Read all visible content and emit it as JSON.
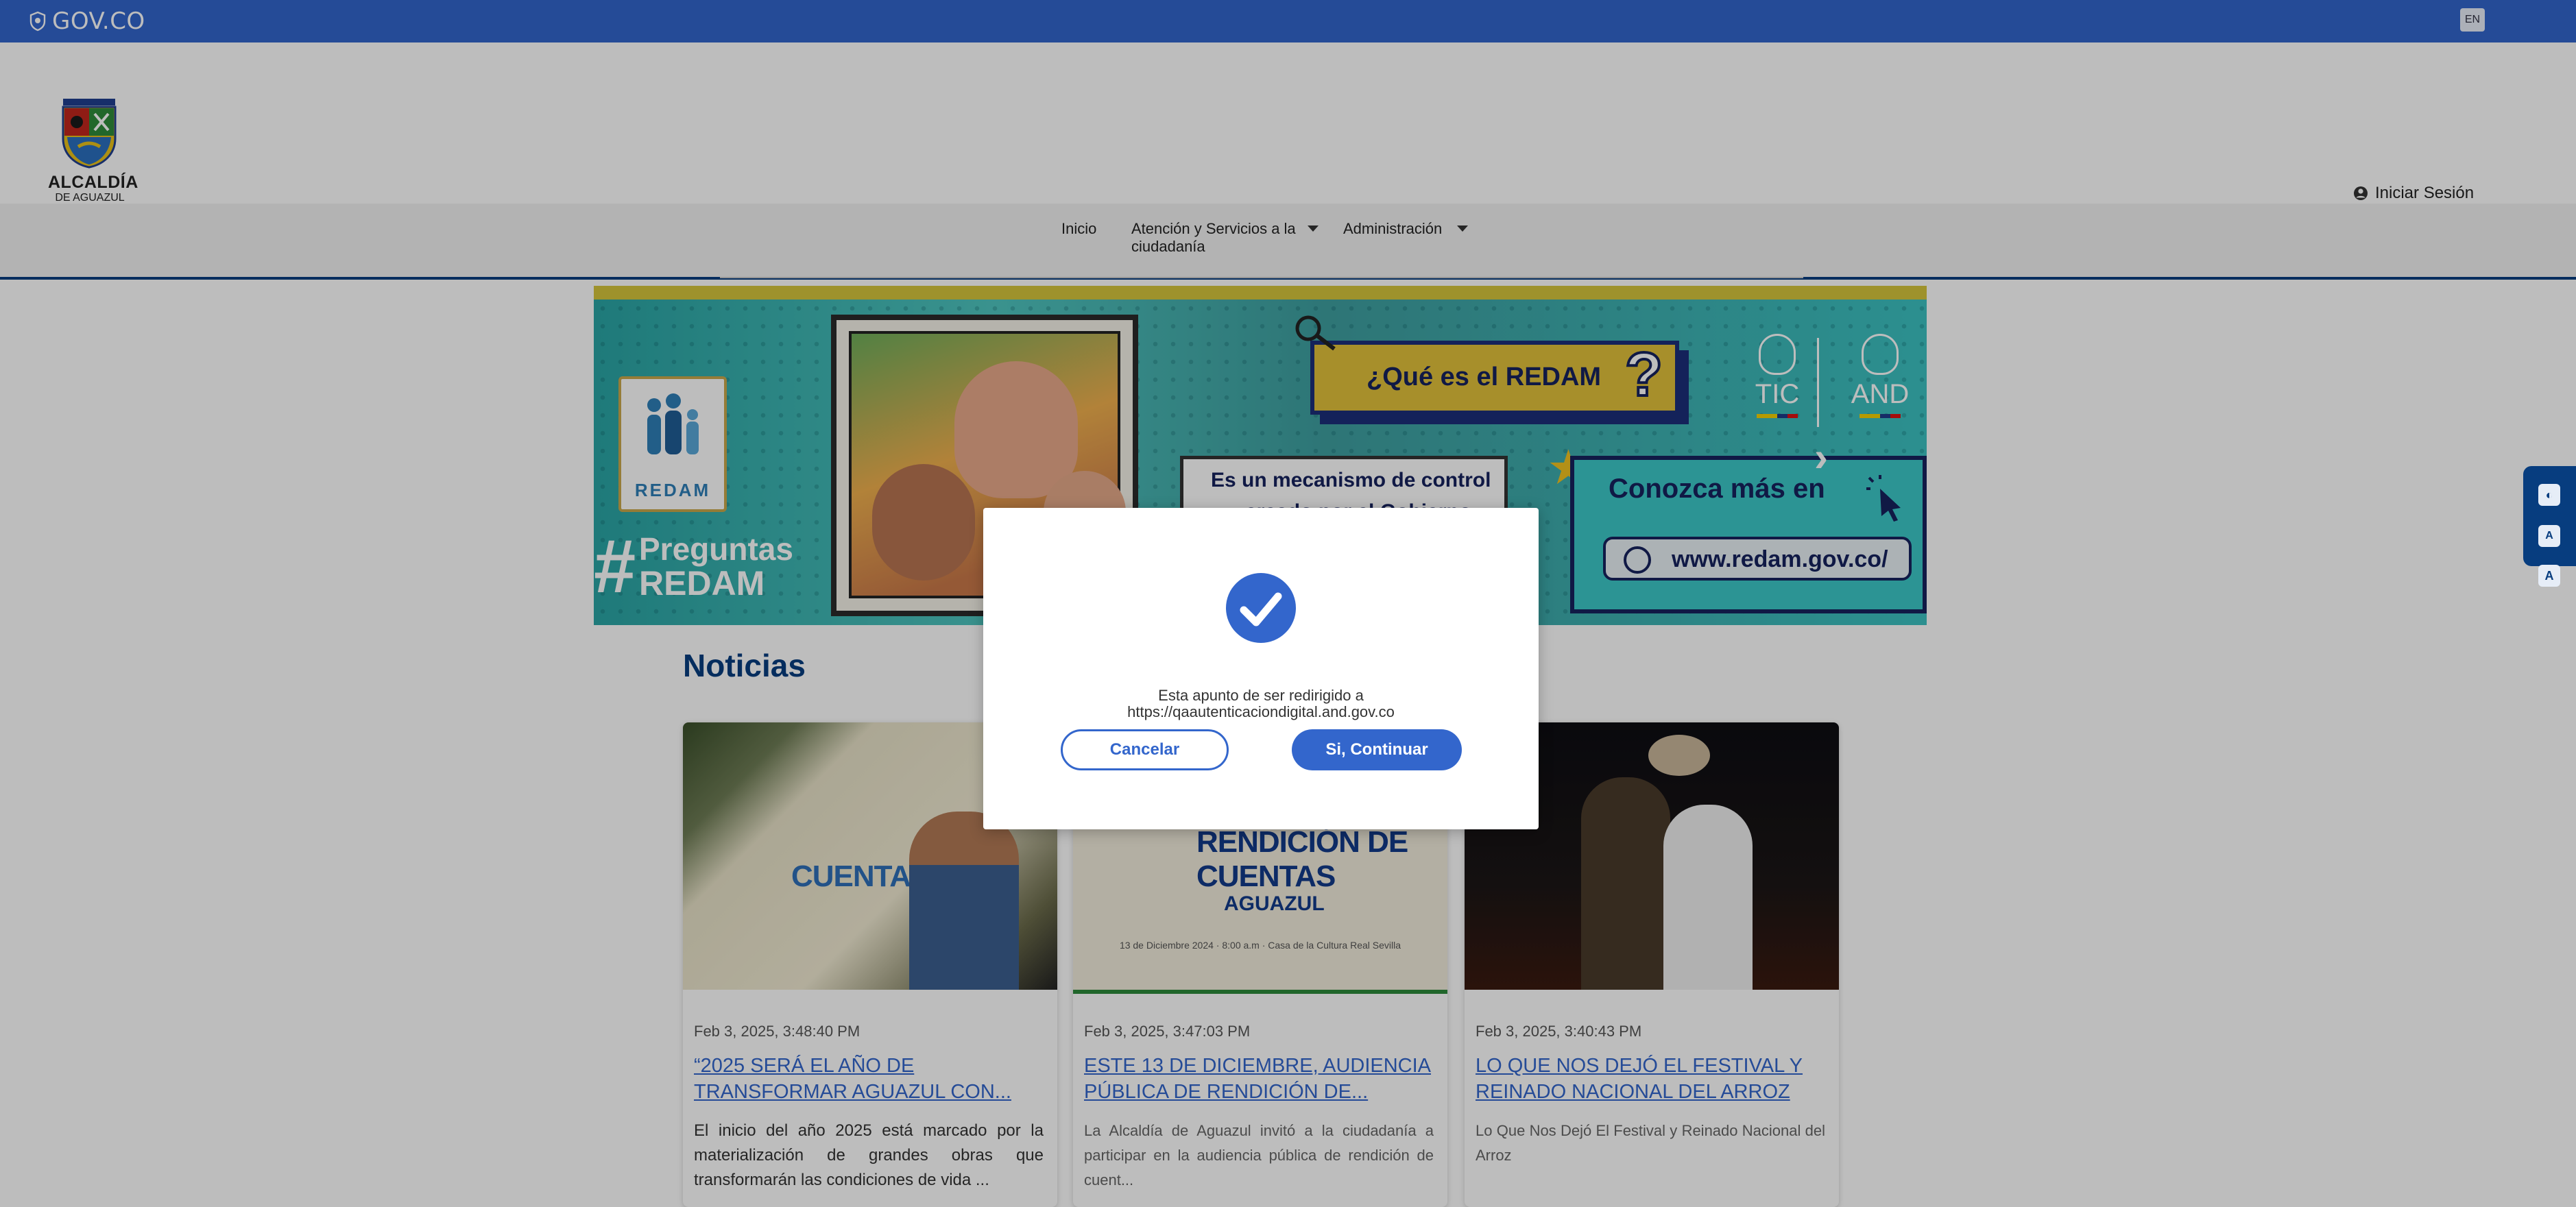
{
  "topbar": {
    "brand": "GOV.CO",
    "lang": "EN"
  },
  "header": {
    "logo_name": "ALCALDÍA",
    "logo_sub": "DE AGUAZUL",
    "login": "Iniciar Sesión"
  },
  "nav": {
    "items": [
      {
        "label": "Inicio"
      },
      {
        "label": "Atención y Servicios a la ciudadanía"
      },
      {
        "label": "Administración"
      }
    ]
  },
  "banner": {
    "logo_text": "REDAM",
    "hashtag": "#",
    "preguntas_l1": "Preguntas",
    "preguntas_l2": "REDAM",
    "question": "¿Qué es el REDAM",
    "question_mark": "?",
    "mecanismo_l1": "Es un mecanismo de control",
    "mecanismo_l2": "creado por el Gobierno",
    "tic": "TIC",
    "and": "AND",
    "conozca": "Conozca más en",
    "url": "www.redam.gov.co/"
  },
  "news": {
    "heading": "Noticias",
    "cards": [
      {
        "image_text": "CUENTAS",
        "date": "Feb 3, 2025, 3:48:40 PM",
        "title": "“2025 SERÁ EL AÑO DE TRANSFORMAR AGUAZUL CON...",
        "desc": "El inicio del año 2025 está marcado por la materialización de grandes obras que transformarán las condiciones de vida ..."
      },
      {
        "image_text": "RENDICIÓN DE CUENTAS",
        "image_sub": "AGUAZUL",
        "image_detail": "13 de Diciembre 2024 · 8:00 a.m · Casa de la Cultura Real Sevilla",
        "date": "Feb 3, 2025, 3:47:03 PM",
        "title": "ESTE 13 DE DICIEMBRE, AUDIENCIA PÚBLICA DE RENDICIÓN DE...",
        "desc": "La Alcaldía de Aguazul invitó a la ciudadanía a participar en la audiencia pública de rendición de cuent..."
      },
      {
        "date": "Feb 3, 2025, 3:40:43 PM",
        "title": "LO QUE NOS DEJÓ EL FESTIVAL Y REINADO NACIONAL DEL ARROZ",
        "desc": "Lo Que Nos Dejó El Festival y Reinado Nacional del Arroz"
      }
    ]
  },
  "modal": {
    "message_l1": "Esta apunto de ser redirigido a",
    "message_l2": "https://qaautenticaciondigital.and.gov.co",
    "cancel": "Cancelar",
    "confirm": "Si, Continuar"
  },
  "a11y": {
    "contrast": "◐",
    "smaller": "A",
    "larger": "A"
  },
  "colors": {
    "primary": "#3366cc",
    "navy": "#073d7f"
  }
}
